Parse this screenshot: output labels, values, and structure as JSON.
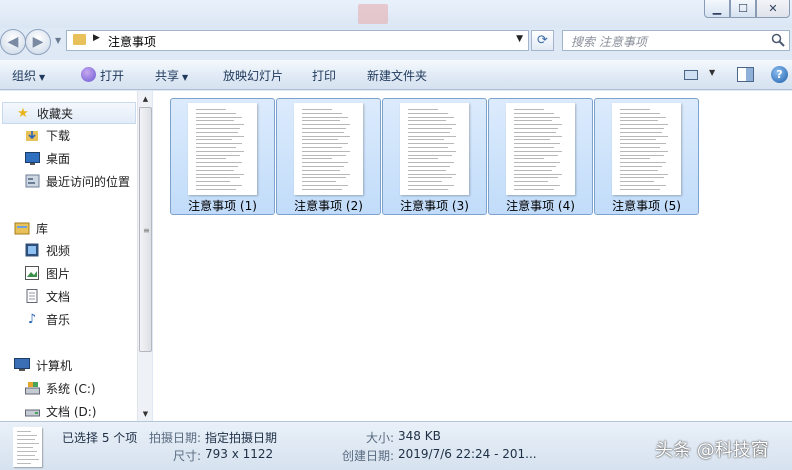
{
  "address": {
    "crumb": "注意事项",
    "search_placeholder": "搜索 注意事项"
  },
  "toolbar": {
    "organize": "组织",
    "open": "打开",
    "share": "共享",
    "slideshow": "放映幻灯片",
    "print": "打印",
    "new_folder": "新建文件夹"
  },
  "nav": {
    "favorites": "收藏夹",
    "downloads": "下载",
    "desktop": "桌面",
    "recent": "最近访问的位置",
    "libraries": "库",
    "videos": "视频",
    "pictures": "图片",
    "documents": "文档",
    "music": "音乐",
    "computer": "计算机",
    "drive_c": "系统 (C:)",
    "drive_d": "文档 (D:)"
  },
  "files": [
    {
      "name": "注意事项 (1)"
    },
    {
      "name": "注意事项 (2)"
    },
    {
      "name": "注意事项 (3)"
    },
    {
      "name": "注意事项 (4)"
    },
    {
      "name": "注意事项 (5)"
    }
  ],
  "status": {
    "selected": "已选择 5 个项",
    "date_taken_label": "拍摄日期:",
    "date_taken_value": "指定拍摄日期",
    "dimensions_label": "尺寸:",
    "dimensions_value": "793 x 1122",
    "size_label": "大小:",
    "size_value": "348 KB",
    "created_label": "创建日期:",
    "created_value": "2019/7/6 22:24 - 201..."
  },
  "watermark": "头条 @科技窗"
}
